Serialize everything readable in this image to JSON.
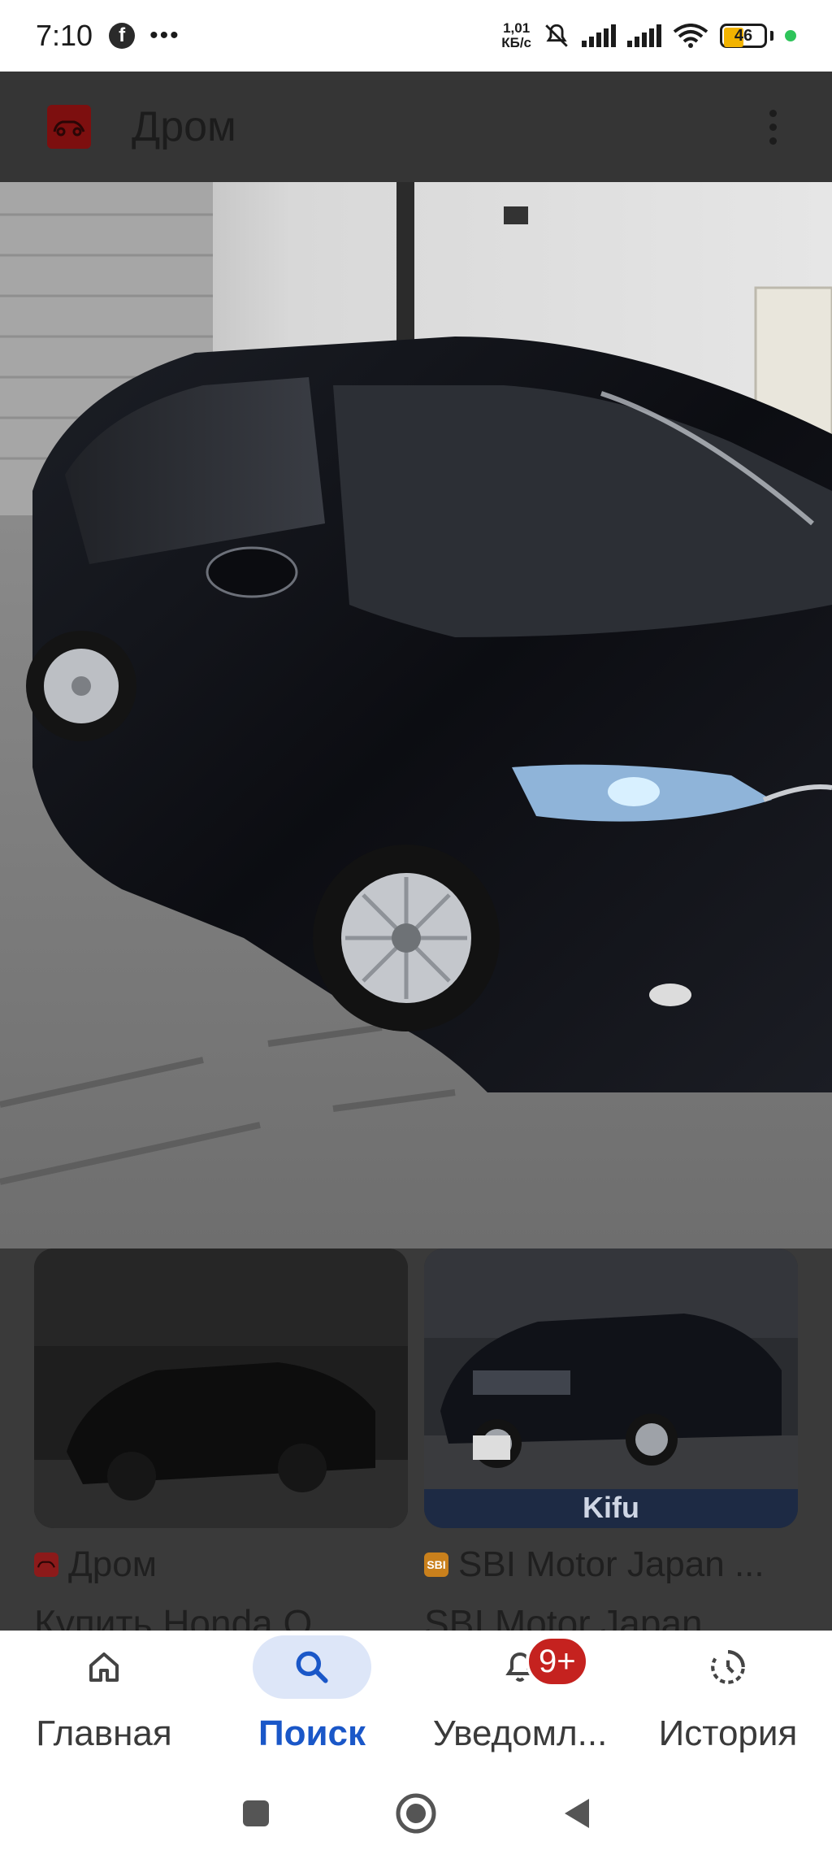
{
  "status_bar": {
    "time": "7:10",
    "notification_app": "f",
    "more_dots": "•••",
    "speed_value": "1,01",
    "speed_unit": "КБ/с",
    "battery": "46"
  },
  "app_bar": {
    "title": "Дром"
  },
  "results": [
    {
      "source": "Дром",
      "title": "Купить Honda O..."
    },
    {
      "source": "SBI Motor Japan ...",
      "title": "SBI Motor Japan ...",
      "source_icon_text": "SBI",
      "thumb_watermark": "Kifu"
    }
  ],
  "bottom_nav": {
    "items": [
      {
        "label": "Главная",
        "icon": "home-icon"
      },
      {
        "label": "Поиск",
        "icon": "search-icon",
        "active": true
      },
      {
        "label": "Уведомл...",
        "icon": "bell-icon",
        "badge": "9+"
      },
      {
        "label": "История",
        "icon": "history-icon"
      }
    ]
  },
  "colors": {
    "active": "#1a57c8",
    "badge": "#c5221f",
    "overlay": "#3a3a3a"
  }
}
